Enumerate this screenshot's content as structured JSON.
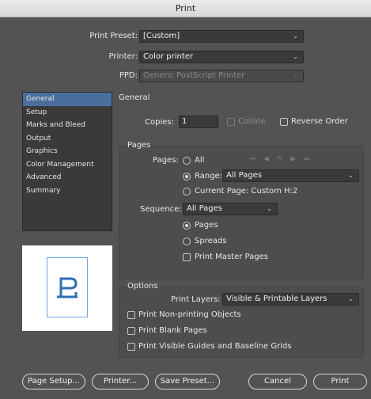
{
  "window": {
    "title": "Print"
  },
  "top": {
    "preset_label": "Print Preset:",
    "preset_value": "[Custom]",
    "printer_label": "Printer:",
    "printer_value": "Color printer",
    "ppd_label": "PPD:",
    "ppd_value": "Generic PostScript Printer"
  },
  "sidebar": {
    "items": [
      {
        "label": "General"
      },
      {
        "label": "Setup"
      },
      {
        "label": "Marks and Bleed"
      },
      {
        "label": "Output"
      },
      {
        "label": "Graphics"
      },
      {
        "label": "Color Management"
      },
      {
        "label": "Advanced"
      },
      {
        "label": "Summary"
      }
    ]
  },
  "preview": {
    "glyph": "P"
  },
  "general": {
    "title": "General",
    "copies_label": "Copies:",
    "copies_value": "1",
    "collate_label": "Collate",
    "reverse_label": "Reverse Order"
  },
  "pages": {
    "title": "Pages",
    "pages_label": "Pages:",
    "all_label": "All",
    "nav_icons": "⏮ ◀ ⎘ ▶ ⏭",
    "range_label": "Range:",
    "range_value": "All Pages",
    "current_label": "Current Page: Custom H:2",
    "sequence_label": "Sequence:",
    "sequence_value": "All Pages",
    "pages_opt": "Pages",
    "spreads_opt": "Spreads",
    "master_label": "Print Master Pages"
  },
  "options": {
    "title": "Options",
    "layers_label": "Print Layers:",
    "layers_value": "Visible & Printable Layers",
    "nonprint_label": "Print Non-printing Objects",
    "blank_label": "Print Blank Pages",
    "guides_label": "Print Visible Guides and Baseline Grids"
  },
  "buttons": {
    "page_setup": "Page Setup...",
    "printer": "Printer...",
    "save_preset": "Save Preset...",
    "cancel": "Cancel",
    "print": "Print"
  },
  "colors": {
    "selection": "#4a6f9c",
    "dialog_bg": "#535353"
  }
}
